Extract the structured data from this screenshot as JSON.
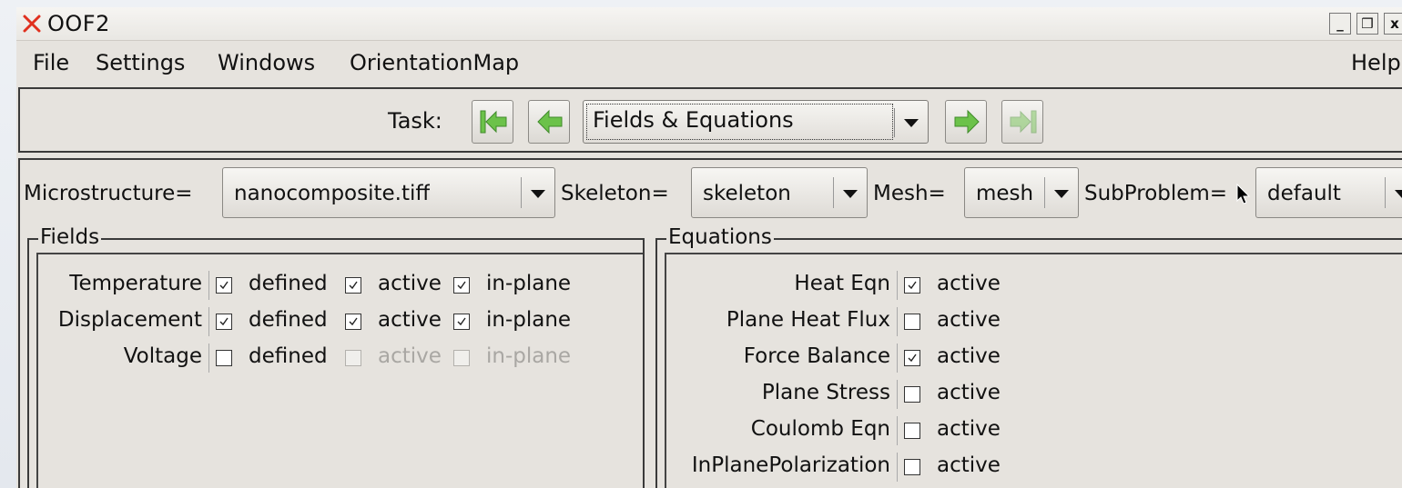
{
  "window": {
    "title": "OOF2",
    "minimize_label": "_",
    "restore_label": "❒",
    "close_label": "x"
  },
  "menu": {
    "file": "File",
    "settings": "Settings",
    "windows": "Windows",
    "orientation_map": "OrientationMap",
    "help": "Help"
  },
  "task": {
    "label": "Task:",
    "selected": "Fields & Equations",
    "buttons": [
      "go-to-first-icon",
      "go-back-icon",
      "go-forward-icon",
      "go-to-last-icon"
    ]
  },
  "selectors": {
    "microstructure_label": "Microstructure=",
    "microstructure_value": "nanocomposite.tiff",
    "skeleton_label": "Skeleton=",
    "skeleton_value": "skeleton",
    "mesh_label": "Mesh=",
    "mesh_value": "mesh",
    "subproblem_label": "SubProblem=",
    "subproblem_value": "default"
  },
  "fields": {
    "title": "Fields",
    "defined_label": "defined",
    "active_label": "active",
    "inplane_label": "in-plane",
    "rows": [
      {
        "name": "Temperature",
        "defined": true,
        "active": true,
        "in_plane": true,
        "enabled": true
      },
      {
        "name": "Displacement",
        "defined": true,
        "active": true,
        "in_plane": true,
        "enabled": true
      },
      {
        "name": "Voltage",
        "defined": false,
        "active": false,
        "in_plane": false,
        "enabled": false
      }
    ]
  },
  "equations": {
    "title": "Equations",
    "active_label": "active",
    "rows": [
      {
        "name": "Heat Eqn",
        "active": true
      },
      {
        "name": "Plane Heat Flux",
        "active": false
      },
      {
        "name": "Force Balance",
        "active": true
      },
      {
        "name": "Plane Stress",
        "active": false
      },
      {
        "name": "Coulomb Eqn",
        "active": false
      },
      {
        "name": "InPlanePolarization",
        "active": false
      }
    ]
  },
  "colors": {
    "accent_green": "#6cc24a",
    "close_x_red": "#e0301e",
    "window_bg": "#e6e3de"
  }
}
